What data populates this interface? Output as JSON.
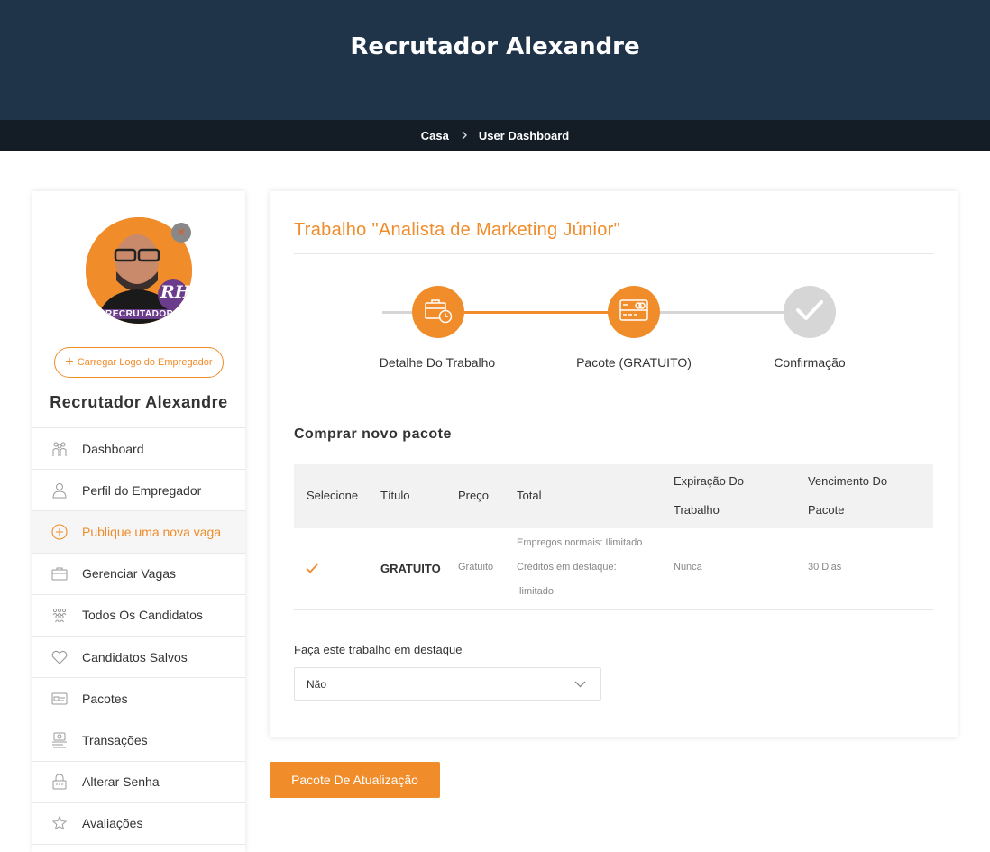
{
  "header": {
    "title": "Recrutador Alexandre"
  },
  "breadcrumb": {
    "home": "Casa",
    "current": "User Dashboard"
  },
  "sidebar": {
    "avatar_text": "RECRUTADOR",
    "avatar_badge": "RH",
    "upload_label": "Carregar Logo do Empregador",
    "name": "Recrutador Alexandre",
    "items": [
      {
        "label": "Dashboard",
        "icon": "people-group-icon"
      },
      {
        "label": "Perfil do Empregador",
        "icon": "user-icon"
      },
      {
        "label": "Publique uma nova vaga",
        "icon": "plus-circle-icon",
        "active": true
      },
      {
        "label": "Gerenciar Vagas",
        "icon": "briefcase-icon"
      },
      {
        "label": "Todos Os Candidatos",
        "icon": "users-icon"
      },
      {
        "label": "Candidatos Salvos",
        "icon": "heart-icon"
      },
      {
        "label": "Pacotes",
        "icon": "card-icon"
      },
      {
        "label": "Transações",
        "icon": "transactions-icon"
      },
      {
        "label": "Alterar Senha",
        "icon": "lock-icon"
      },
      {
        "label": "Avaliações",
        "icon": "star-icon"
      }
    ]
  },
  "main": {
    "job_title": "Trabalho \"Analista de Marketing Júnior\"",
    "steps": [
      {
        "label": "Detalhe Do Trabalho",
        "icon": "briefcase-clock-icon",
        "state": "done"
      },
      {
        "label": "Pacote (GRATUITO)",
        "icon": "credit-card-icon",
        "state": "active"
      },
      {
        "label": "Confirmação",
        "icon": "check-icon",
        "state": "pending"
      }
    ],
    "section_title": "Comprar novo pacote",
    "table": {
      "headers": {
        "select": "Selecione",
        "title": "Título",
        "price": "Preço",
        "total": "Total",
        "job_expiry_1": "Expiração Do",
        "job_expiry_2": "Trabalho",
        "pkg_expiry_1": "Vencimento Do",
        "pkg_expiry_2": "Pacote"
      },
      "row": {
        "title": "GRATUITO",
        "price": "Gratuito",
        "total_1": "Empregos normais: Ilimitado",
        "total_2": "Créditos em destaque:",
        "total_3": "Ilimitado",
        "job_expiry": "Nunca",
        "pkg_expiry": "30 Dias"
      }
    },
    "featured_label": "Faça este trabalho em destaque",
    "featured_value": "Não"
  },
  "upgrade_button": "Pacote De Atualização",
  "colors": {
    "accent": "#f08c2a",
    "header": "#1f3349",
    "crumb": "#141c26",
    "pending": "#d6d6d6"
  }
}
